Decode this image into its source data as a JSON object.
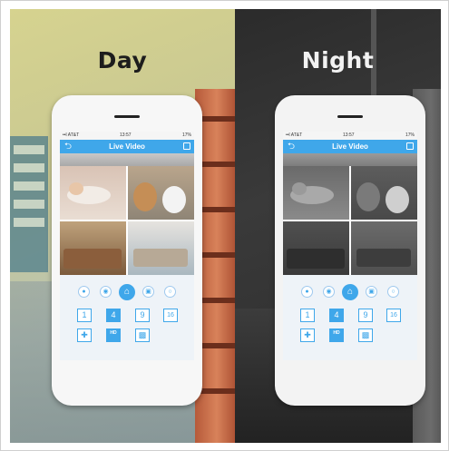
{
  "panels": [
    {
      "key": "day",
      "title": "Day",
      "app": {
        "status_left": "••l AT&T",
        "status_time": "13:57",
        "status_right": "17%",
        "back_icon": "back-arrow-icon",
        "screen_title": "Live Video",
        "fullscreen_icon": "fullscreen-icon",
        "controls": [
          "mic-icon",
          "speaker-icon",
          "home-icon",
          "camera-icon",
          "record-icon"
        ],
        "grid_buttons": [
          "1",
          "4",
          "9",
          "16"
        ],
        "selected_grid": "4",
        "extra_buttons": [
          "ptz-icon",
          "HD",
          "snapshot-icon"
        ]
      }
    },
    {
      "key": "night",
      "title": "Night",
      "app": {
        "status_left": "••l AT&T",
        "status_time": "13:57",
        "status_right": "17%",
        "back_icon": "back-arrow-icon",
        "screen_title": "Live Video",
        "fullscreen_icon": "fullscreen-icon",
        "controls": [
          "mic-icon",
          "speaker-icon",
          "home-icon",
          "camera-icon",
          "record-icon"
        ],
        "grid_buttons": [
          "1",
          "4",
          "9",
          "16"
        ],
        "selected_grid": "4",
        "extra_buttons": [
          "ptz-icon",
          "HD",
          "snapshot-icon"
        ]
      }
    }
  ],
  "colors": {
    "accent": "#3fa7ea"
  }
}
